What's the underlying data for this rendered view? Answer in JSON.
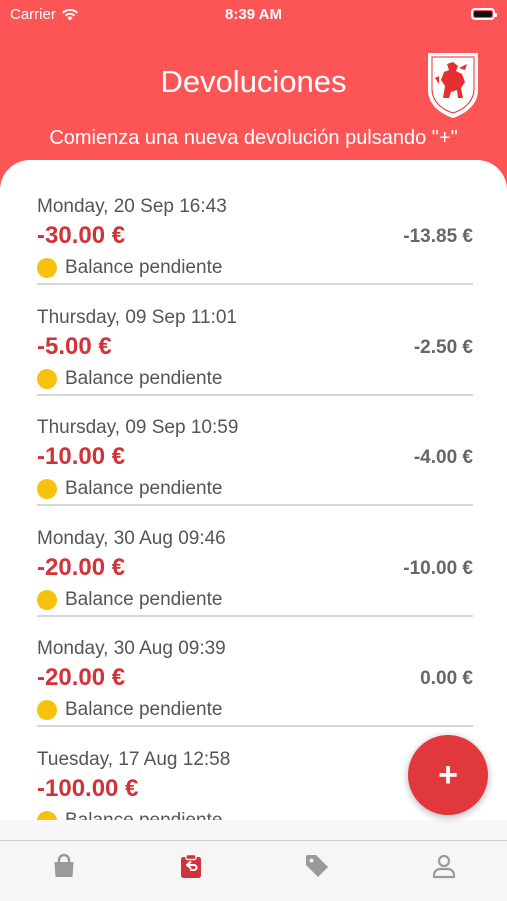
{
  "status_bar": {
    "carrier": "Carrier",
    "time": "8:39 AM"
  },
  "header": {
    "title": "Devoluciones",
    "subtitle": "Comienza una nueva devolución pulsando \"+\""
  },
  "returns": [
    {
      "date": "Monday, 20 Sep 16:43",
      "amount": "-30.00 €",
      "secondary": "-13.85 €",
      "status": "Balance pendiente"
    },
    {
      "date": "Thursday, 09 Sep 11:01",
      "amount": "-5.00 €",
      "secondary": "-2.50 €",
      "status": "Balance pendiente"
    },
    {
      "date": "Thursday, 09 Sep 10:59",
      "amount": "-10.00 €",
      "secondary": "-4.00 €",
      "status": "Balance pendiente"
    },
    {
      "date": "Monday, 30 Aug 09:46",
      "amount": "-20.00 €",
      "secondary": "-10.00 €",
      "status": "Balance pendiente"
    },
    {
      "date": "Monday, 30 Aug 09:39",
      "amount": "-20.00 €",
      "secondary": "0.00 €",
      "status": "Balance pendiente"
    },
    {
      "date": "Tuesday, 17 Aug 12:58",
      "amount": "-100.00 €",
      "secondary": "",
      "status": "Balance pendiente"
    }
  ],
  "fab": {
    "label": "+"
  },
  "tabs": [
    {
      "icon": "shopping-bag-icon",
      "active": false
    },
    {
      "icon": "returns-icon",
      "active": true
    },
    {
      "icon": "tag-icon",
      "active": false
    },
    {
      "icon": "profile-icon",
      "active": false
    }
  ],
  "colors": {
    "header": "#fd5556",
    "amount": "#d0343a",
    "pending_dot": "#f8c10e",
    "fab": "#e0383d",
    "tab_active": "#d0343a",
    "tab_inactive": "#9a9a9a"
  }
}
